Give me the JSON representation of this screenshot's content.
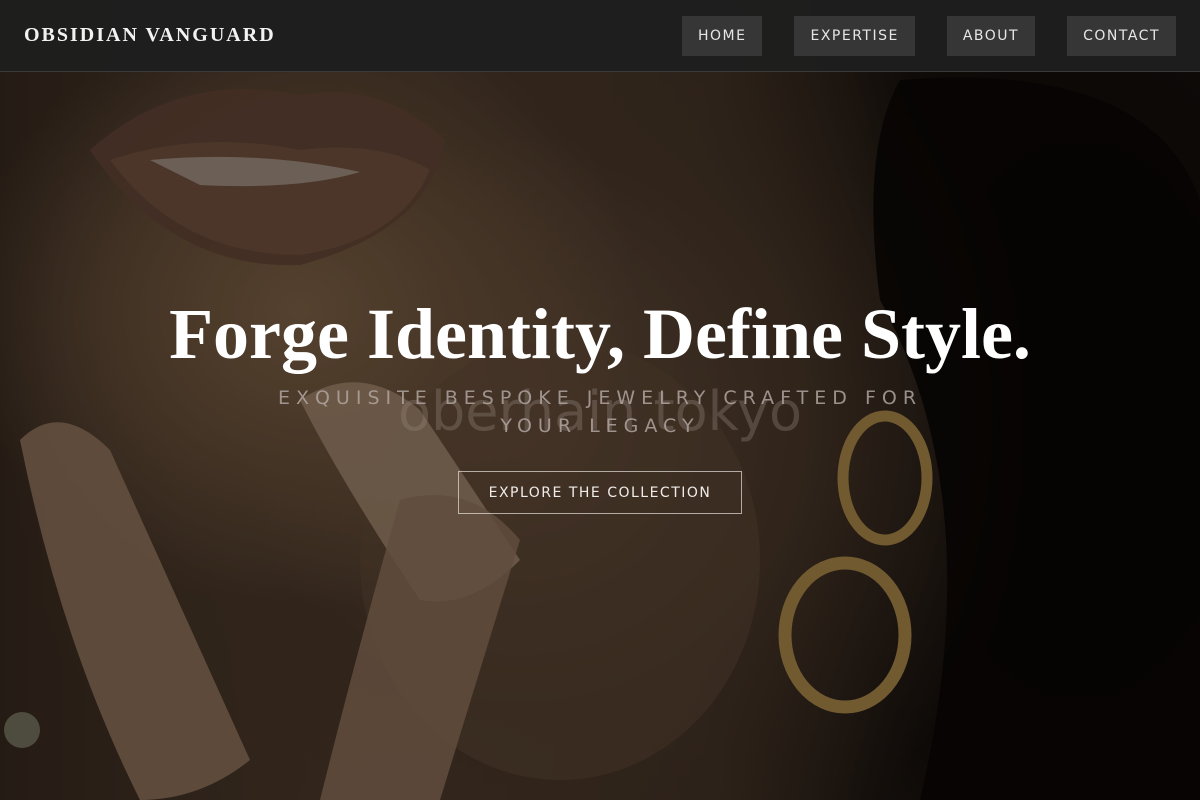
{
  "header": {
    "brand": "OBSIDIAN VANGUARD",
    "nav": [
      {
        "label": "HOME"
      },
      {
        "label": "EXPERTISE"
      },
      {
        "label": "ABOUT"
      },
      {
        "label": "CONTACT"
      }
    ]
  },
  "hero": {
    "headline": "Forge Identity, Define Style.",
    "tagline": "EXQUISITE BESPOKE JEWELRY CRAFTED FOR YOUR LEGACY",
    "watermark": "oberhain tokyo",
    "cta_label": "EXPLORE THE COLLECTION"
  },
  "colors": {
    "header_bg": "#1e1e1e",
    "nav_button_bg": "#363636",
    "headline": "#ffffff",
    "gold_accent": "#b8924e"
  },
  "icons": {
    "hero_image": "portrait-gold-earrings-image"
  }
}
